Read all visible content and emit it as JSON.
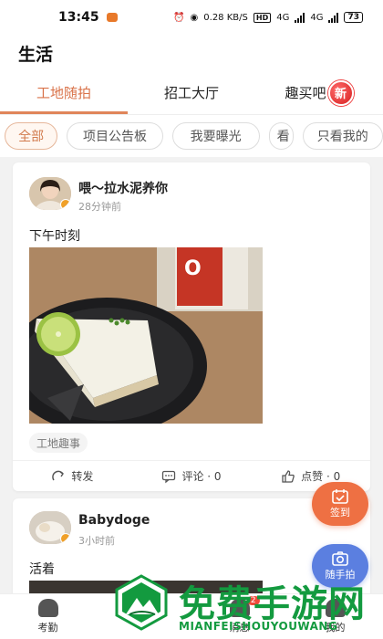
{
  "status_bar": {
    "time": "13:45",
    "speed": "0.28 KB/S",
    "hd": "HD",
    "net1": "4G",
    "net2": "4G",
    "battery": "73"
  },
  "header": {
    "title": "生活"
  },
  "tabs": [
    {
      "label": "工地随拍",
      "active": true
    },
    {
      "label": "招工大厅",
      "active": false
    },
    {
      "label": "趣买吧",
      "active": false,
      "badge": "新"
    }
  ],
  "filters": [
    {
      "label": "全部",
      "active": true
    },
    {
      "label": "项目公告板",
      "active": false
    },
    {
      "label": "我要曝光",
      "active": false
    },
    {
      "label": "看",
      "active": false
    },
    {
      "label": "只看我的",
      "active": false
    }
  ],
  "posts": [
    {
      "username": "喂～拉水泥养你",
      "time": "28分钟前",
      "text": "下午时刻",
      "tag": "工地趣事",
      "actions": {
        "share": "转发",
        "comment": "评论 · 0",
        "like": "点赞 · 0"
      }
    },
    {
      "username": "Babydoge",
      "time": "3小时前",
      "text": "活着"
    }
  ],
  "fabs": {
    "sign_in": "签到",
    "snapshot": "随手拍"
  },
  "bottom_nav": [
    {
      "label": "考勤"
    },
    {
      "label": ""
    },
    {
      "label": "消息",
      "badge": "2"
    },
    {
      "label": "我的"
    }
  ],
  "watermark": {
    "title": "免费手游网",
    "subtitle": "MIANFEISHOUYOUWANG"
  },
  "colors": {
    "accent": "#d9734a",
    "sign_fab": "#ee7043",
    "photo_fab": "#5b7fe0",
    "watermark": "#139a3f"
  }
}
